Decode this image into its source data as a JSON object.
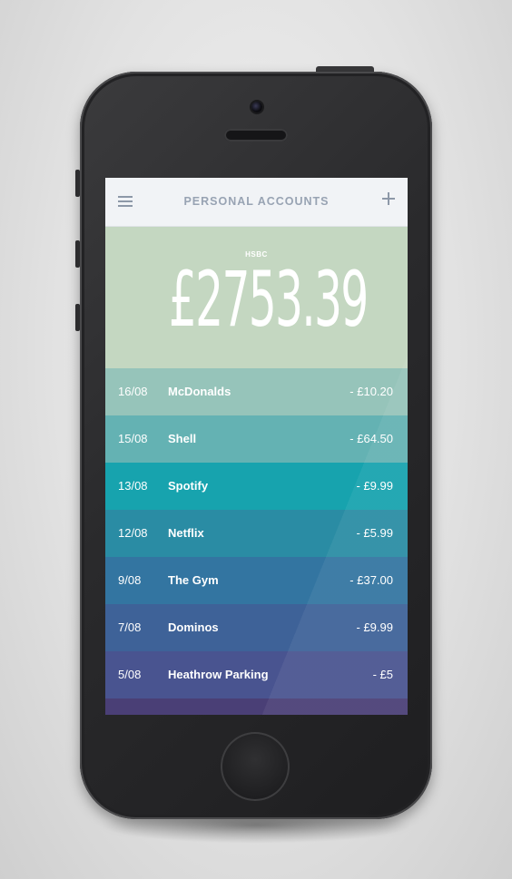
{
  "header": {
    "title": "PERSONAL ACCOUNTS"
  },
  "icons": {
    "menu": "hamburger-menu-icon",
    "add": "plus-icon"
  },
  "account": {
    "bank": "HSBC",
    "balance": "£2753.39"
  },
  "transactions": [
    {
      "date": "16/08",
      "merchant": "McDonalds",
      "amount": "- £10.20",
      "color": "#96c4ba"
    },
    {
      "date": "15/08",
      "merchant": "Shell",
      "amount": "- £64.50",
      "color": "#64b2b3"
    },
    {
      "date": "13/08",
      "merchant": "Spotify",
      "amount": "- £9.99",
      "color": "#17a3ae"
    },
    {
      "date": "12/08",
      "merchant": "Netflix",
      "amount": "- £5.99",
      "color": "#2a8ca4"
    },
    {
      "date": "9/08",
      "merchant": "The Gym",
      "amount": "- £37.00",
      "color": "#3375a1"
    },
    {
      "date": "7/08",
      "merchant": "Dominos",
      "amount": "- £9.99",
      "color": "#3e6298"
    },
    {
      "date": "5/08",
      "merchant": "Heathrow Parking",
      "amount": "- £5",
      "color": "#495490"
    }
  ],
  "colors": {
    "topbar": "#f1f3f6",
    "balance_panel": "#c4d7c1",
    "bottom_strip": "#4a3f76"
  }
}
